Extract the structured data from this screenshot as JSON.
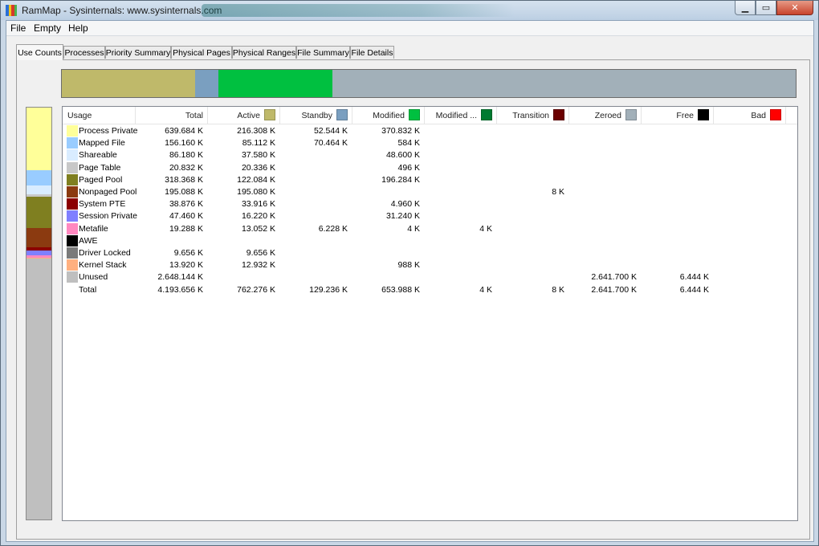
{
  "window": {
    "title": "RamMap - Sysinternals: www.sysinternals.com",
    "app_icon_colors": [
      "#2a6fd6",
      "#f0c419",
      "#d63a2a",
      "#4bb34b"
    ],
    "caption_buttons": {
      "minimize": "▁",
      "maximize": "▭",
      "close": "✕"
    }
  },
  "menu": {
    "items": [
      "File",
      "Empty",
      "Help"
    ]
  },
  "tabs": [
    {
      "label": "Use Counts",
      "active": true
    },
    {
      "label": "Processes"
    },
    {
      "label": "Priority Summary"
    },
    {
      "label": "Physical Pages"
    },
    {
      "label": "Physical Ranges"
    },
    {
      "label": "File Summary"
    },
    {
      "label": "File Details"
    }
  ],
  "overview_bar": {
    "segments": [
      {
        "name": "Active",
        "color": "#bfb96a",
        "fraction": 0.182
      },
      {
        "name": "Standby",
        "color": "#7a9fc0",
        "fraction": 0.031
      },
      {
        "name": "Modified",
        "color": "#00c040",
        "fraction": 0.156
      },
      {
        "name": "Zeroed",
        "color": "#a2b0b9",
        "fraction": 0.631
      }
    ]
  },
  "usage_bar": {
    "segments": [
      {
        "name": "Process Private",
        "color": "#ffff99",
        "fraction": 0.153
      },
      {
        "name": "Mapped File",
        "color": "#99ccff",
        "fraction": 0.037
      },
      {
        "name": "Shareable",
        "color": "#d9ecff",
        "fraction": 0.021
      },
      {
        "name": "Page Table",
        "color": "#c8c8c8",
        "fraction": 0.005
      },
      {
        "name": "Paged Pool",
        "color": "#7f7f20",
        "fraction": 0.076
      },
      {
        "name": "Nonpaged Pool",
        "color": "#8b3a10",
        "fraction": 0.047
      },
      {
        "name": "System PTE",
        "color": "#8b0000",
        "fraction": 0.009
      },
      {
        "name": "Session Private",
        "color": "#7f7fff",
        "fraction": 0.011
      },
      {
        "name": "Metafile",
        "color": "#ff88c0",
        "fraction": 0.005
      },
      {
        "name": "Kernel Stack",
        "color": "#ffb080",
        "fraction": 0.003
      },
      {
        "name": "Unused",
        "color": "#bfbfbf",
        "fraction": 0.633
      }
    ]
  },
  "table": {
    "columns": [
      {
        "label": "Usage"
      },
      {
        "label": "Total"
      },
      {
        "label": "Active",
        "color": "#bfb96a"
      },
      {
        "label": "Standby",
        "color": "#7a9fc0"
      },
      {
        "label": "Modified",
        "color": "#00c040"
      },
      {
        "label": "Modified ...",
        "color": "#007a30"
      },
      {
        "label": "Transition",
        "color": "#6b0000"
      },
      {
        "label": "Zeroed",
        "color": "#a2b0b9"
      },
      {
        "label": "Free",
        "color": "#000000"
      },
      {
        "label": "Bad",
        "color": "#ff0000"
      }
    ],
    "rows": [
      {
        "usage": "Process Private",
        "color": "#ffff99",
        "values": [
          "639.684 K",
          "216.308 K",
          "52.544 K",
          "370.832 K",
          "",
          "",
          "",
          "",
          ""
        ]
      },
      {
        "usage": "Mapped File",
        "color": "#99ccff",
        "values": [
          "156.160 K",
          "85.112 K",
          "70.464 K",
          "584 K",
          "",
          "",
          "",
          "",
          ""
        ]
      },
      {
        "usage": "Shareable",
        "color": "#d9ecff",
        "values": [
          "86.180 K",
          "37.580 K",
          "",
          "48.600 K",
          "",
          "",
          "",
          "",
          ""
        ]
      },
      {
        "usage": "Page Table",
        "color": "#c8c8c8",
        "values": [
          "20.832 K",
          "20.336 K",
          "",
          "496 K",
          "",
          "",
          "",
          "",
          ""
        ]
      },
      {
        "usage": "Paged Pool",
        "color": "#7f7f20",
        "values": [
          "318.368 K",
          "122.084 K",
          "",
          "196.284 K",
          "",
          "",
          "",
          "",
          ""
        ]
      },
      {
        "usage": "Nonpaged Pool",
        "color": "#8b3a10",
        "values": [
          "195.088 K",
          "195.080 K",
          "",
          "",
          "",
          "8 K",
          "",
          "",
          ""
        ]
      },
      {
        "usage": "System PTE",
        "color": "#8b0000",
        "values": [
          "38.876 K",
          "33.916 K",
          "",
          "4.960 K",
          "",
          "",
          "",
          "",
          ""
        ]
      },
      {
        "usage": "Session Private",
        "color": "#7f7fff",
        "values": [
          "47.460 K",
          "16.220 K",
          "",
          "31.240 K",
          "",
          "",
          "",
          "",
          ""
        ]
      },
      {
        "usage": "Metafile",
        "color": "#ff88c0",
        "values": [
          "19.288 K",
          "13.052 K",
          "6.228 K",
          "4 K",
          "4 K",
          "",
          "",
          "",
          ""
        ]
      },
      {
        "usage": "AWE",
        "color": "#000000",
        "values": [
          "",
          "",
          "",
          "",
          "",
          "",
          "",
          "",
          ""
        ]
      },
      {
        "usage": "Driver Locked",
        "color": "#7a7a7a",
        "values": [
          "9.656 K",
          "9.656 K",
          "",
          "",
          "",
          "",
          "",
          "",
          ""
        ]
      },
      {
        "usage": "Kernel Stack",
        "color": "#ffb080",
        "values": [
          "13.920 K",
          "12.932 K",
          "",
          "988 K",
          "",
          "",
          "",
          "",
          ""
        ]
      },
      {
        "usage": "Unused",
        "color": "#bfbfbf",
        "values": [
          "2.648.144 K",
          "",
          "",
          "",
          "",
          "",
          "2.641.700 K",
          "6.444 K",
          ""
        ]
      },
      {
        "usage": "Total",
        "color": "",
        "values": [
          "4.193.656 K",
          "762.276 K",
          "129.236 K",
          "653.988 K",
          "4 K",
          "8 K",
          "2.641.700 K",
          "6.444 K",
          ""
        ]
      }
    ]
  }
}
